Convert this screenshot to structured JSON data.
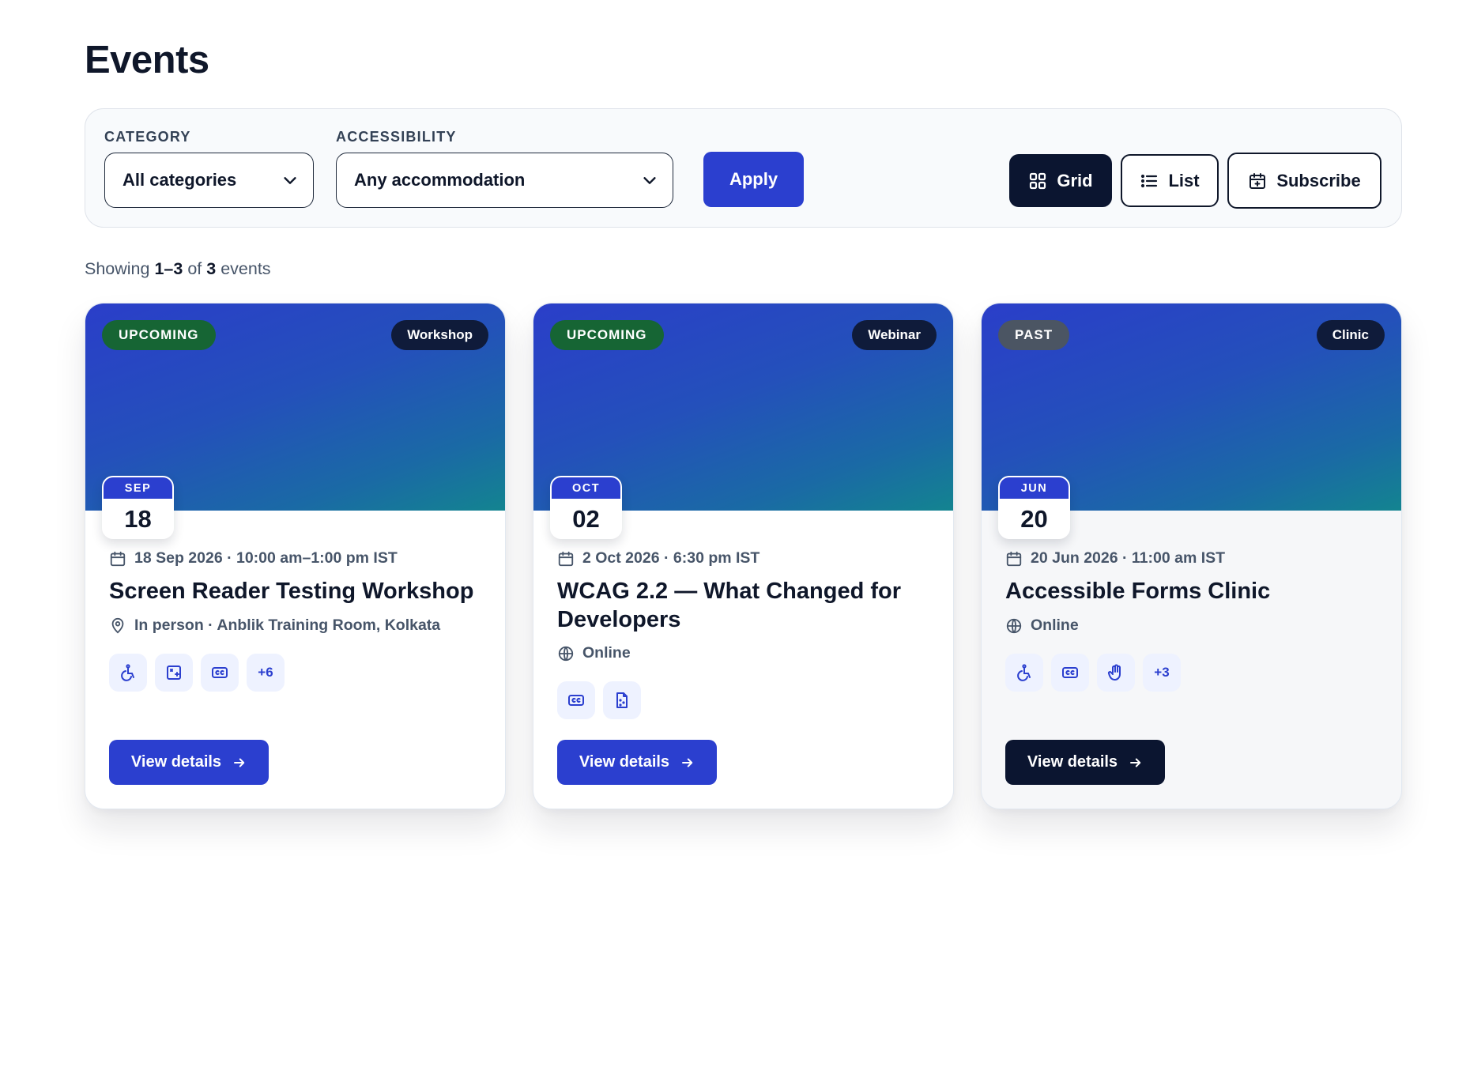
{
  "page": {
    "title": "Events"
  },
  "filters": {
    "category": {
      "label": "CATEGORY",
      "value": "All categories"
    },
    "accessibility": {
      "label": "ACCESSIBILITY",
      "value": "Any accommodation"
    },
    "apply_label": "Apply"
  },
  "view_controls": {
    "grid_label": "Grid",
    "list_label": "List",
    "subscribe_label": "Subscribe",
    "active": "Grid"
  },
  "summary": {
    "prefix": "Showing",
    "range": "1–3",
    "of": "of",
    "total": "3",
    "suffix": "events"
  },
  "colors": {
    "accent": "#2b3fcf",
    "dark": "#0b1530",
    "upcoming": "#166534",
    "past": "#4b5563",
    "hero_start": "#2a3ec9",
    "hero_end": "#138490"
  },
  "events": [
    {
      "status": "UPCOMING",
      "type": "Workshop",
      "month": "SEP",
      "day": "18",
      "datetime": "18 Sep 2026 · 10:00 am–1:00 pm IST",
      "title": "Screen Reader Testing Workshop",
      "location": "In person · Anblik Training Room, Kolkata",
      "location_icon": "map-pin-icon",
      "accessibility_icons": [
        "wheelchair-icon",
        "sign-language-icon",
        "captions-icon"
      ],
      "more": "+6",
      "cta": "View details"
    },
    {
      "status": "UPCOMING",
      "type": "Webinar",
      "month": "OCT",
      "day": "02",
      "datetime": "2 Oct 2026 · 6:30 pm IST",
      "title": "WCAG 2.2 — What Changed for Developers",
      "location": "Online",
      "location_icon": "globe-icon",
      "accessibility_icons": [
        "captions-icon",
        "braille-document-icon"
      ],
      "more": "",
      "cta": "View details"
    },
    {
      "status": "PAST",
      "type": "Clinic",
      "month": "JUN",
      "day": "20",
      "datetime": "20 Jun 2026 · 11:00 am IST",
      "title": "Accessible Forms Clinic",
      "location": "Online",
      "location_icon": "globe-icon",
      "accessibility_icons": [
        "wheelchair-icon",
        "captions-icon",
        "hand-icon"
      ],
      "more": "+3",
      "cta": "View details"
    }
  ]
}
